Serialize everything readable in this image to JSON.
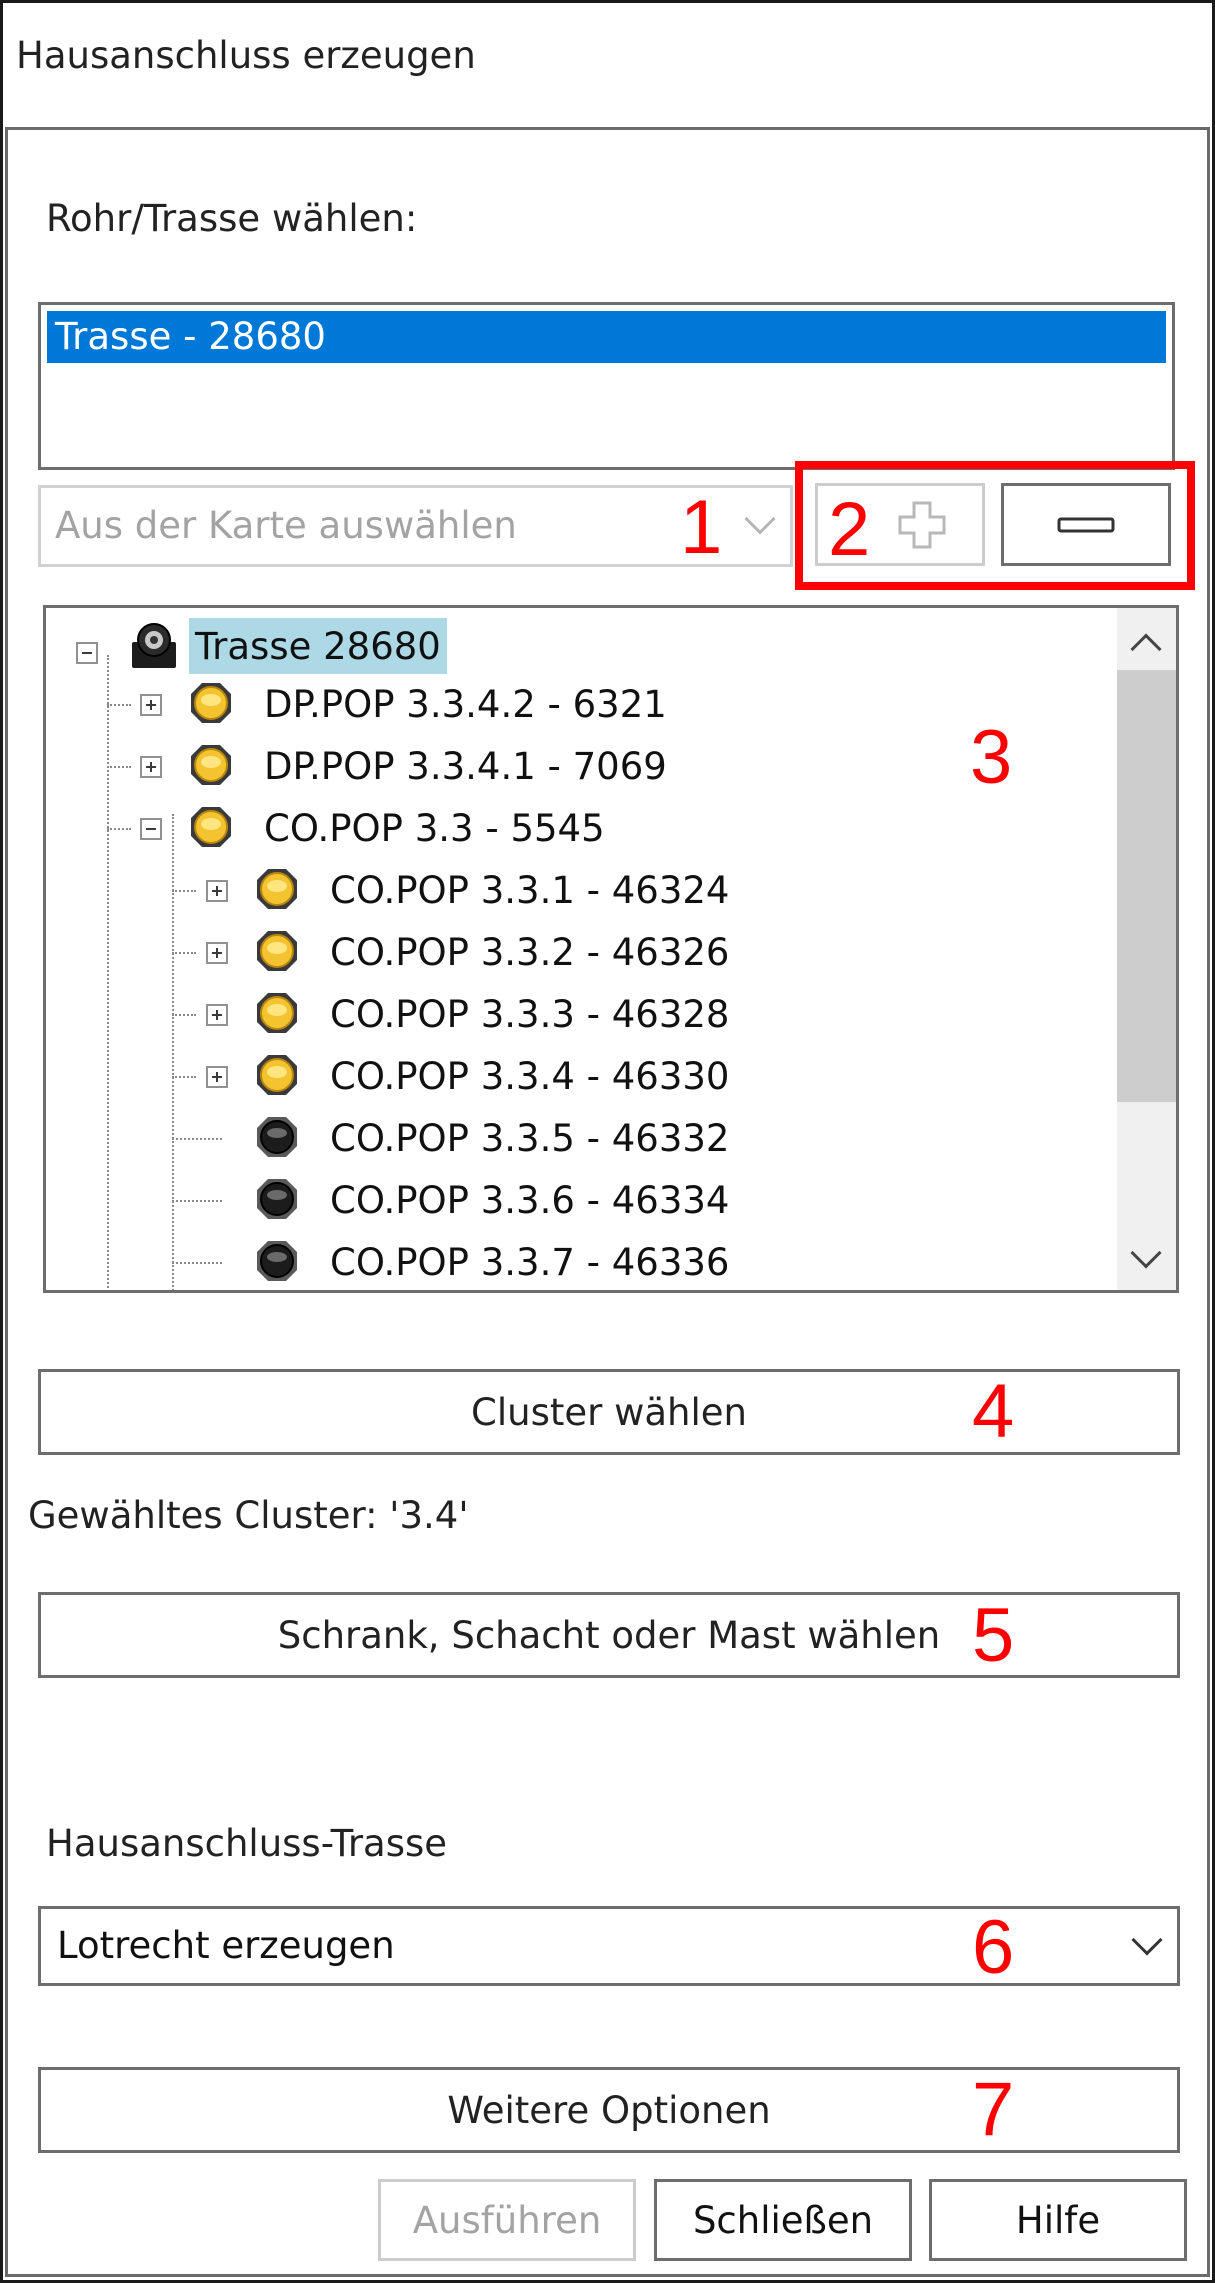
{
  "window": {
    "title": "Hausanschluss erzeugen"
  },
  "pipe_section": {
    "label": "Rohr/Trasse wählen:",
    "list_items": [
      "Trasse - 28680"
    ],
    "map_select": {
      "placeholder": "Aus der Karte auswählen",
      "icon": "chevron-down-icon"
    },
    "add_button_icon": "plus-icon",
    "remove_button_icon": "minus-icon"
  },
  "tree": {
    "root": {
      "label": "Trasse 28680",
      "icon": "route-node-icon"
    },
    "level1": [
      {
        "label": "DP.POP 3.3.4.2 - 6321",
        "expander": "plus"
      },
      {
        "label": "DP.POP 3.3.4.1 - 7069",
        "expander": "plus"
      },
      {
        "label": "CO.POP 3.3 - 5545",
        "expander": "minus"
      }
    ],
    "level2": [
      {
        "label": "CO.POP 3.3.1 - 46324",
        "icon": "gold-node-icon",
        "expander": "plus"
      },
      {
        "label": "CO.POP 3.3.2 - 46326",
        "icon": "gold-node-icon",
        "expander": "plus"
      },
      {
        "label": "CO.POP 3.3.3 - 46328",
        "icon": "gold-node-icon",
        "expander": "plus"
      },
      {
        "label": "CO.POP 3.3.4 - 46330",
        "icon": "gold-node-icon",
        "expander": "plus"
      },
      {
        "label": "CO.POP 3.3.5 - 46332",
        "icon": "black-node-icon",
        "expander": "none"
      },
      {
        "label": "CO.POP 3.3.6 - 46334",
        "icon": "black-node-icon",
        "expander": "none"
      },
      {
        "label": "CO.POP 3.3.7 - 46336",
        "icon": "black-node-icon",
        "expander": "none"
      }
    ]
  },
  "cluster": {
    "button_label": "Cluster wählen",
    "selected_text": "Gewähltes Cluster: '3.4'"
  },
  "cabinet_button_label": "Schrank, Schacht oder Mast wählen",
  "connection_route": {
    "label": "Hausanschluss-Trasse",
    "selected_value": "Lotrecht erzeugen"
  },
  "more_options_label": "Weitere Optionen",
  "footer": {
    "execute_label": "Ausführen",
    "close_label": "Schließen",
    "help_label": "Hilfe"
  },
  "annotations": [
    "1",
    "2",
    "3",
    "4",
    "5",
    "6",
    "7"
  ],
  "colors": {
    "selection": "#0078d7",
    "root_highlight": "#add8e6",
    "annotation_red": "#ff0000",
    "gold_node": "#f4c430",
    "border": "#6d6d6d"
  }
}
